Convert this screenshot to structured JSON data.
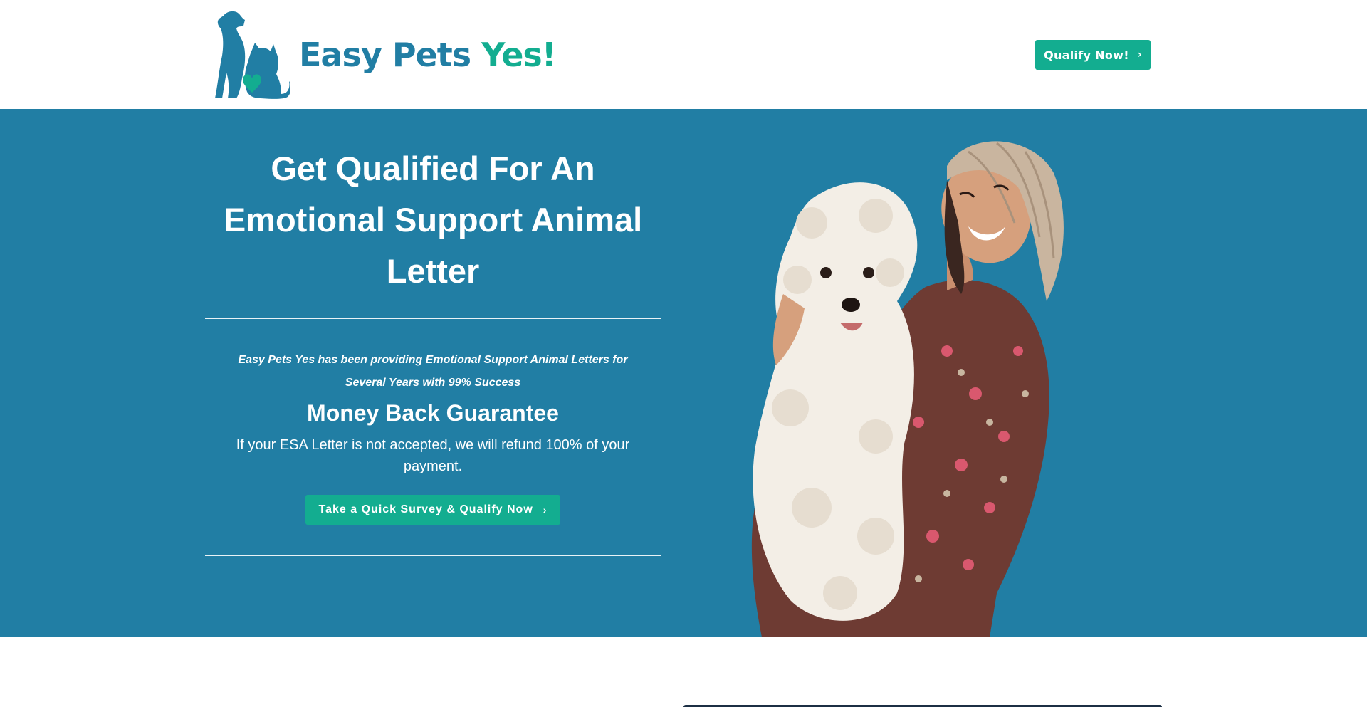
{
  "header": {
    "logo": {
      "word1": "Easy Pets",
      "word2": "Yes!",
      "icon": "dog-cat-heart-logo-icon"
    },
    "cta": {
      "label": "Qualify Now!",
      "icon": "chevron-right-icon"
    }
  },
  "hero": {
    "title": "Get Qualified For An Emotional Support Animal Letter",
    "subtitle": "Easy Pets Yes has been providing Emotional Support Animal Letters for Several Years with 99% Success",
    "guarantee_heading": "Money Back Guarantee",
    "guarantee_text": "If your ESA Letter is not accepted, we will refund 100% of your payment.",
    "survey_button": {
      "label": "Take a Quick Survey & Qualify Now",
      "icon": "chevron-right-icon"
    },
    "photo": "woman-hugging-white-poodle-photo"
  },
  "colors": {
    "brand_blue": "#217ea4",
    "brand_green": "#13ad90",
    "white": "#ffffff"
  }
}
